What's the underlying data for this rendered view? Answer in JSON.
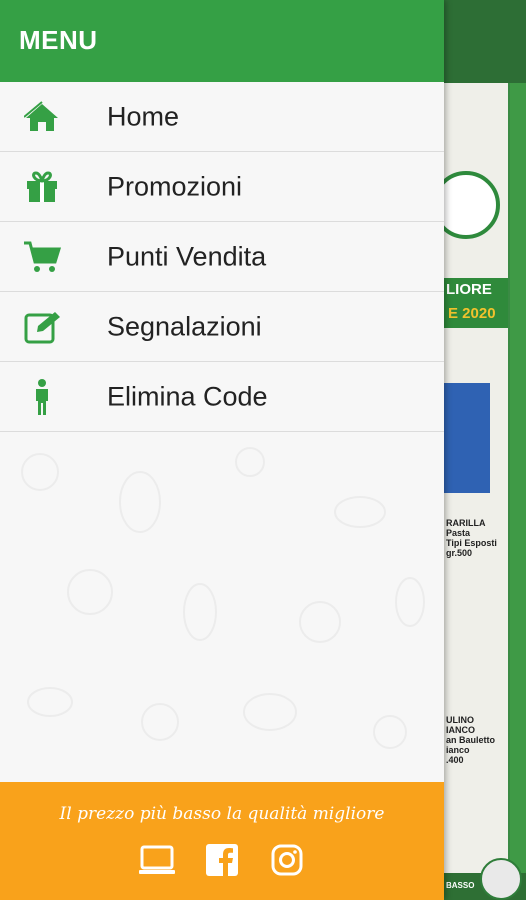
{
  "menu": {
    "title": "MENU",
    "items": [
      {
        "label": "Home",
        "icon": "home-icon"
      },
      {
        "label": "Promozioni",
        "icon": "gift-icon"
      },
      {
        "label": "Punti Vendita",
        "icon": "cart-icon"
      },
      {
        "label": "Segnalazioni",
        "icon": "edit-icon"
      },
      {
        "label": "Elimina Code",
        "icon": "person-icon"
      }
    ]
  },
  "footer": {
    "slogan": "Il prezzo più basso la qualità migliore",
    "social": [
      "tablet-icon",
      "facebook-icon",
      "instagram-icon"
    ]
  },
  "background": {
    "banner_line1": "LIORE",
    "banner_line2": "E 2020",
    "product1_lines": [
      "RARILLA",
      "Pasta",
      "Tipi Esposti",
      "gr.500"
    ],
    "product2_lines": [
      "ULINO",
      "IANCO",
      "an Bauletto",
      "ianco",
      ".400"
    ],
    "bottom_text": "BASSO"
  },
  "colors": {
    "accent": "#35a045",
    "footer": "#f9a21b"
  }
}
